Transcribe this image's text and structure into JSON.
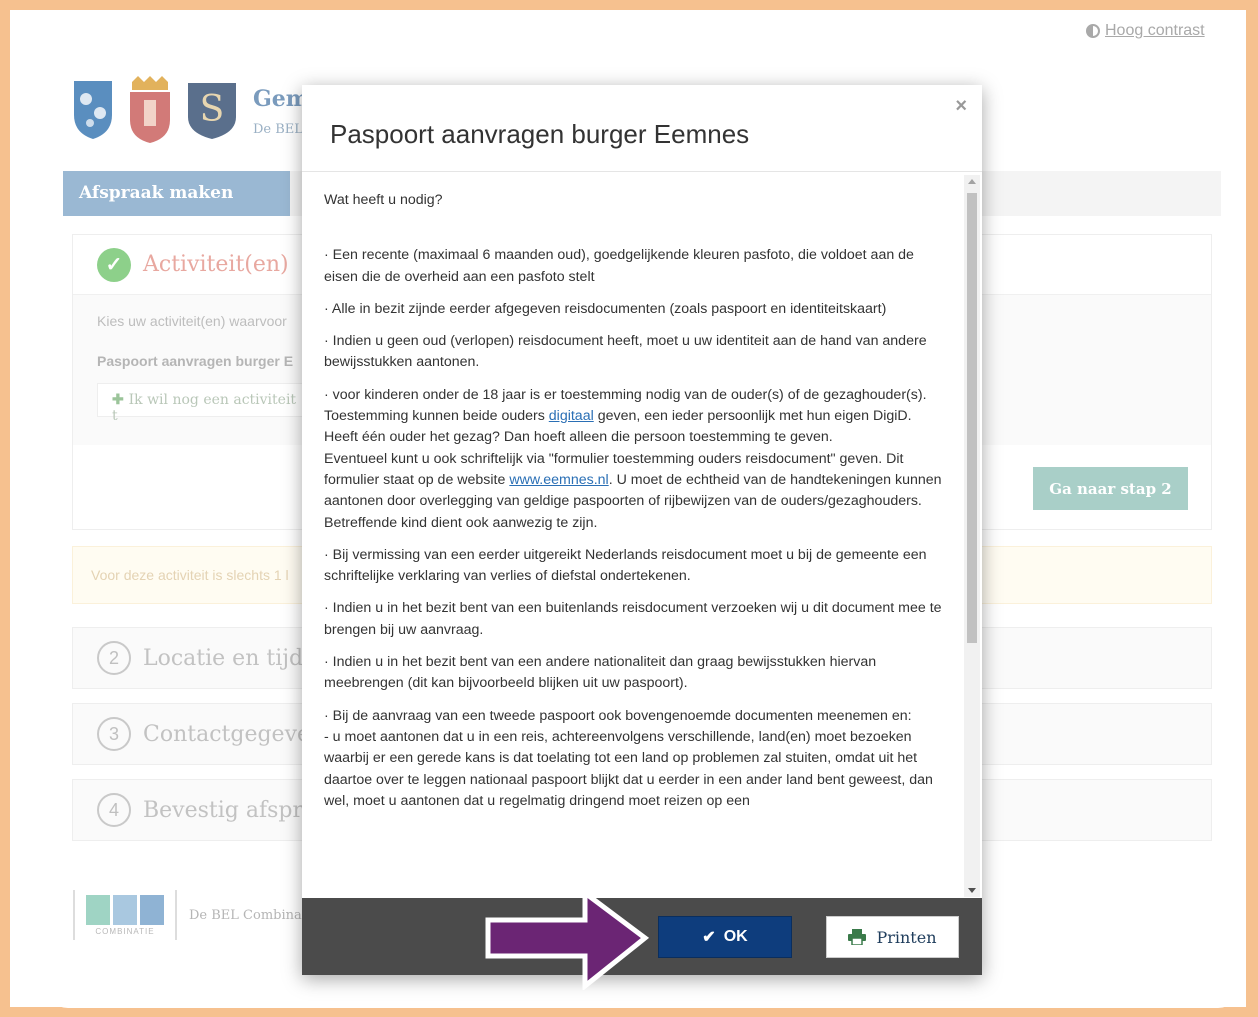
{
  "top_link": "Hoog contrast",
  "header": {
    "org_name": "Gem",
    "org_sub": "De BEL"
  },
  "tab": {
    "active_label": "Afspraak maken"
  },
  "step1": {
    "title": "Activiteit(en)",
    "choose_text": "Kies uw activiteit(en) waarvoor",
    "activity_name": "Paspoort aanvragen burger E",
    "add_activity": "Ik wil nog een activiteit t",
    "next_button": "Ga naar stap 2"
  },
  "notice": "Voor deze activiteit is slechts 1 l",
  "steps": [
    {
      "num": "2",
      "title": "Locatie en tijdst"
    },
    {
      "num": "3",
      "title": "Contactgegever"
    },
    {
      "num": "4",
      "title": "Bevestig afspraa"
    }
  ],
  "footer": {
    "logo_sub": "COMBINATIE",
    "text": "De BEL Combinat"
  },
  "modal": {
    "title": "Paspoort aanvragen burger Eemnes",
    "close": "×",
    "intro": "Wat heeft u nodig?",
    "p1": "·   Een recente (maximaal 6 maanden oud), goedgelijkende kleuren pasfoto, die voldoet aan de eisen die de overheid aan een pasfoto stelt",
    "p2": "·         Alle in bezit zijnde eerder afgegeven reisdocumenten (zoals paspoort en identiteitskaart)",
    "p3": "·         Indien u geen oud (verlopen) reisdocument heeft, moet u uw identiteit aan de hand van andere bewijsstukken aantonen.",
    "p4_a": "·         voor kinderen onder de 18 jaar is er toestemming nodig van de ouder(s) of de gezaghouder(s). Toestemming kunnen beide ouders ",
    "p4_link": "digitaal",
    "p4_b": " geven, een ieder persoonlijk met hun eigen DigiD. Heeft één ouder het gezag? Dan hoeft alleen die persoon toestemming te geven.",
    "p4_c": "Eventueel kunt u ook schriftelijk via \"formulier toestemming ouders reisdocument\" geven. Dit formulier staat op de website ",
    "p4_link2": "www.eemnes.nl",
    "p4_d": ". U moet de echtheid van de handtekeningen kunnen aantonen door overlegging van geldige paspoorten of rijbewijzen van de ouders/gezaghouders.",
    "p4_e": "Betreffende kind dient ook aanwezig te zijn.",
    "p5": "·         Bij vermissing van een eerder uitgereikt Nederlands reisdocument moet u bij de gemeente een schriftelijke verklaring van verlies of diefstal ondertekenen.",
    "p6": "·    Indien u in het bezit bent van een buitenlands reisdocument verzoeken wij u dit document mee te brengen bij uw aanvraag.",
    "p7": "·    Indien u in het bezit bent van een andere nationaliteit dan graag bewijsstukken hiervan meebrengen (dit kan bijvoorbeeld blijken uit uw paspoort).",
    "p8": "·       Bij de aanvraag van een tweede paspoort ook bovengenoemde documenten meenemen en:",
    "p8_b": "- u moet aantonen dat u in een reis, achtereenvolgens verschillende, land(en) moet bezoeken waarbij er een gerede kans is dat toelating tot een land op problemen zal stuiten, omdat uit het daartoe over te leggen nationaal paspoort blijkt dat u eerder in een ander land bent geweest, dan wel, moet u aantonen dat u regelmatig dringend moet reizen op een",
    "ok_label": "OK",
    "print_label": "Printen"
  },
  "colors": {
    "frame_border": "#f6c18f",
    "ok_button": "#0e3d7d",
    "footer_bar": "#4b4b4b",
    "arrow": "#6b2574"
  }
}
